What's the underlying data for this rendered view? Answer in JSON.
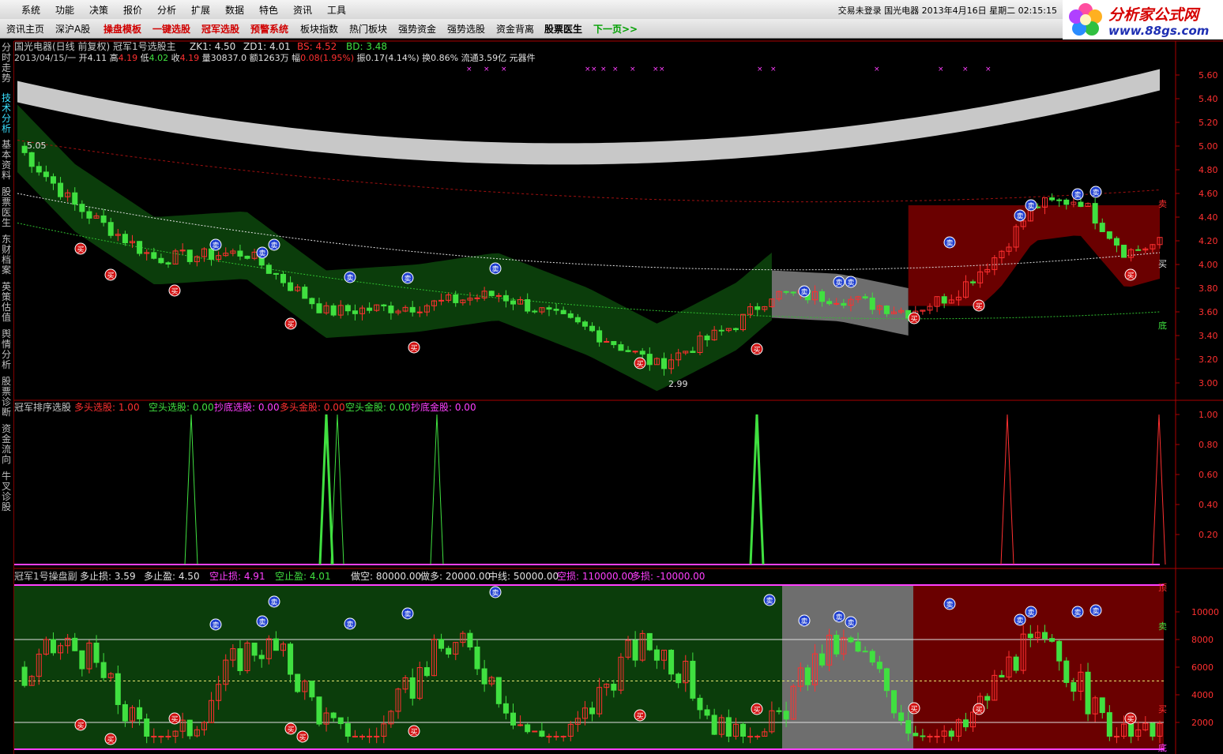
{
  "menu": {
    "items": [
      "系统",
      "功能",
      "决策",
      "报价",
      "分析",
      "扩展",
      "数据",
      "特色",
      "资讯",
      "工具"
    ],
    "status": "交易未登录  国光电器  2013年4月16日  星期二  02:15:15"
  },
  "toolbar": {
    "items": [
      {
        "label": "资讯主页",
        "color": "#000000"
      },
      {
        "label": "深沪A股",
        "color": "#000000"
      },
      {
        "label": "操盘模板",
        "color": "#d00000"
      },
      {
        "label": "一键选股",
        "color": "#d00000"
      },
      {
        "label": "冠军选股",
        "color": "#d00000"
      },
      {
        "label": "预警系统",
        "color": "#d00000"
      },
      {
        "label": "板块指数",
        "color": "#000000"
      },
      {
        "label": "热门板块",
        "color": "#000000"
      },
      {
        "label": "强势资金",
        "color": "#000000"
      },
      {
        "label": "强势选股",
        "color": "#000000"
      },
      {
        "label": "资金背离",
        "color": "#000000"
      },
      {
        "label": "股票医生",
        "color": "#000000"
      },
      {
        "label": "下一页>>",
        "color": "#00a000"
      }
    ]
  },
  "logo": {
    "title": "分析家公式网",
    "url": "www.88gs.com"
  },
  "side_tabs": [
    "分时走势",
    "技术分析",
    "基本资料",
    "股票医生",
    "东财档案",
    "英策估值",
    "舆情分析",
    "股票诊断",
    "资金流向",
    "牛叉诊股"
  ],
  "main_panel": {
    "title": "国光电器(日线 前复权) 冠军1号选股主",
    "zk1": "ZK1: 4.50",
    "zd1": "ZD1: 4.01",
    "bs": "BS: 4.52",
    "bd": "BD: 3.48",
    "quote": {
      "date": "2013/04/15/一",
      "open_label": "开",
      "open": "4.11",
      "high_label": "高",
      "high": "4.19",
      "low_label": "低",
      "low": "4.02",
      "close_label": "收",
      "close": "4.19",
      "vol_label": "量",
      "vol": "30837.0",
      "amt_label": "额",
      "amt": "1263万",
      "chg_label": "幅",
      "chg": "0.08(1.95%)",
      "amp_label": "振",
      "amp": "0.17(4.14%)",
      "turn_label": "换",
      "turn": "0.86%",
      "float_label": "流通",
      "float": "3.59亿",
      "sector": "元器件"
    },
    "high_mark": "5.05",
    "low_mark": "2.99",
    "right_labels": {
      "sell": "卖",
      "buy": "买",
      "bottom": "底"
    },
    "y_ticks": [
      "5.60",
      "5.40",
      "5.20",
      "5.00",
      "4.80",
      "4.60",
      "4.40",
      "4.20",
      "4.00",
      "3.80",
      "3.60",
      "3.40",
      "3.20",
      "3.00"
    ]
  },
  "panel2": {
    "title": "冠军排序选股",
    "duotou": "多头选股: 1.00",
    "kongtou": "空头选股: 0.00",
    "chaodi": "抄底选股: 0.00",
    "duotou_gold": "多头金股: 0.00",
    "kongtou_gold": "空头金股: 0.00",
    "chaodi_gold": "抄底金股: 0.00",
    "y_ticks": [
      "1.00",
      "0.80",
      "0.60",
      "0.40",
      "0.20"
    ]
  },
  "panel3": {
    "title": "冠军1号操盘副",
    "duo_zhisun": "多止损: 3.59",
    "duo_zhiying": "多止盈: 4.50",
    "kong_zhisun": "空止损: 4.91",
    "kong_zhiying": "空止盈: 4.01",
    "zuokong": "做空: 80000.00",
    "zuoduo": "做多: 20000.00",
    "zhongxian": "中线: 50000.00",
    "kongsun": "空损: 110000.00",
    "duosun": "多损: -10000.00",
    "right_labels": {
      "top": "顶",
      "sell": "卖",
      "buy": "买",
      "bottom": "底"
    },
    "y_ticks": [
      "10000",
      "8000",
      "6000",
      "4000",
      "2000"
    ]
  },
  "signals": {
    "buy": "买",
    "sell": "卖"
  },
  "colors": {
    "up": "#ff3030",
    "down": "#40e040",
    "band_green": "#0b3d0b",
    "band_red": "#6a0000",
    "band_gray": "#6e6e6e",
    "axis": "#aa0000",
    "magenta": "#ff40ff"
  }
}
